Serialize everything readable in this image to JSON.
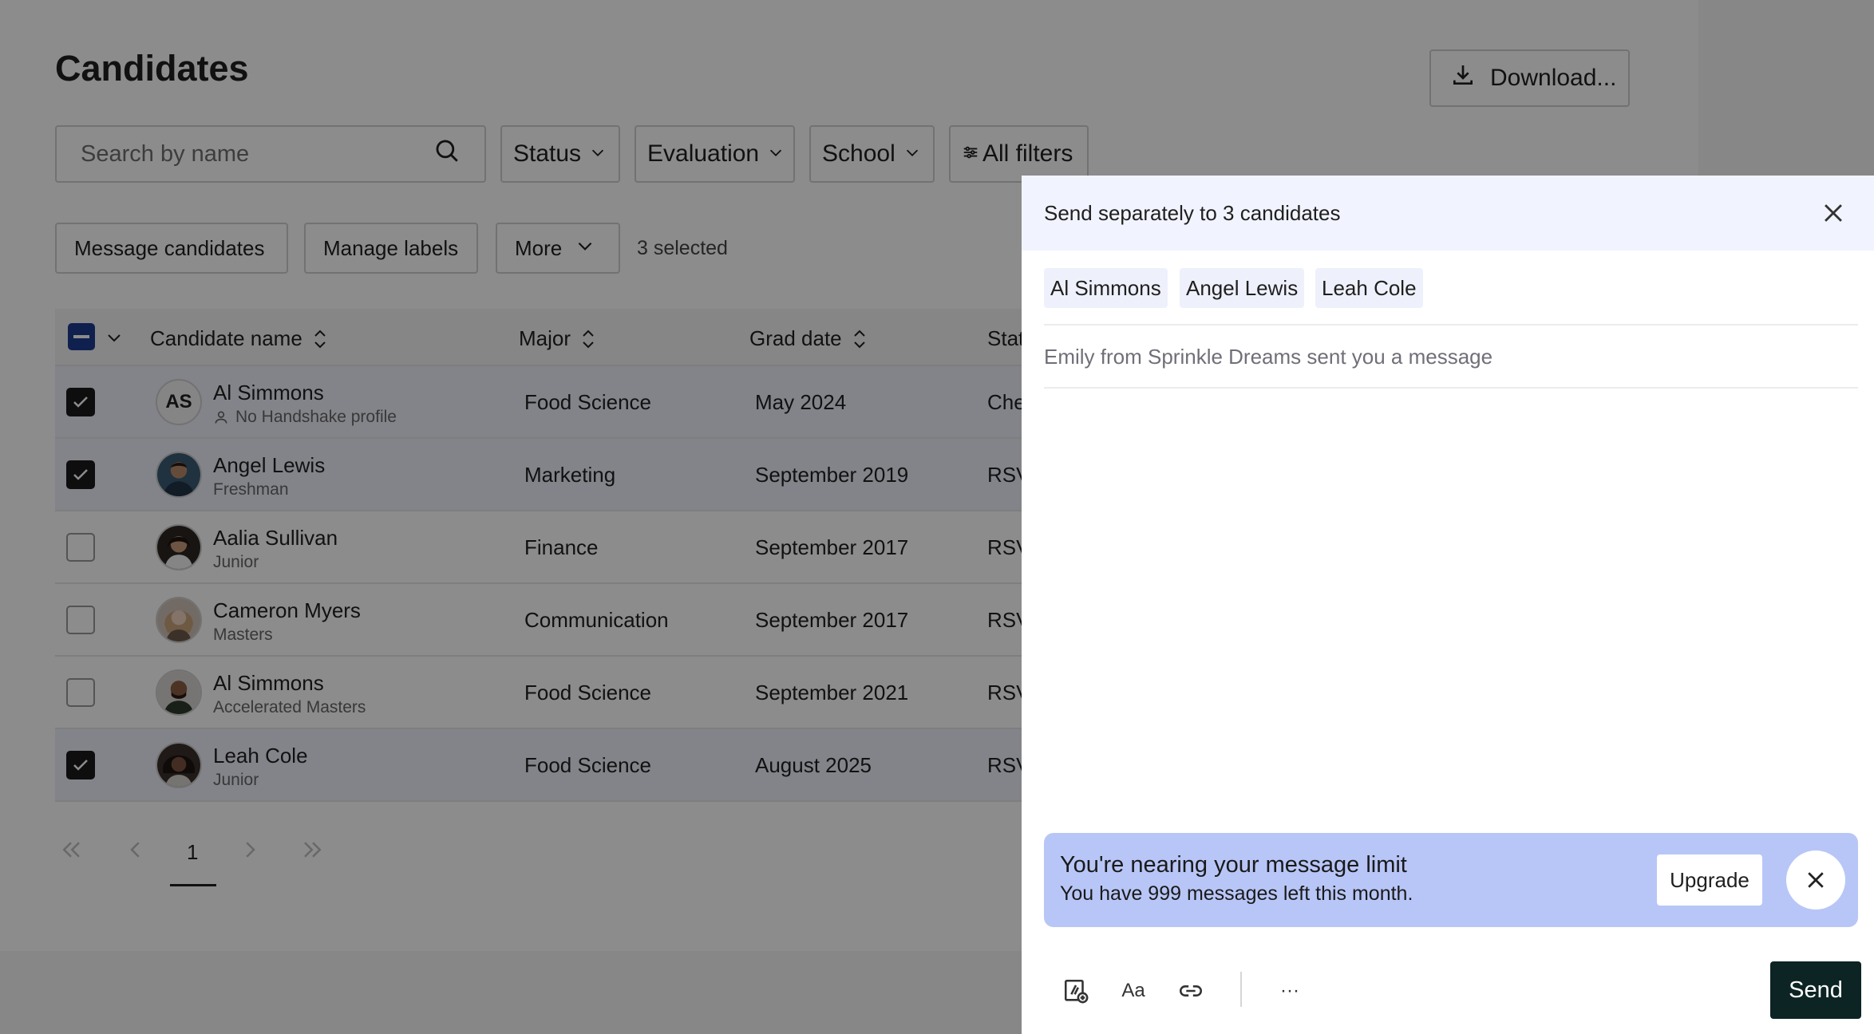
{
  "page": {
    "title": "Candidates",
    "download_label": "Download..."
  },
  "search": {
    "placeholder": "Search by name"
  },
  "filters": [
    {
      "label": "Status"
    },
    {
      "label": "Evaluation"
    },
    {
      "label": "School"
    },
    {
      "label": "All filters"
    }
  ],
  "actions": {
    "message_candidates": "Message candidates",
    "manage_labels": "Manage labels",
    "more": "More",
    "selected_count": "3 selected"
  },
  "table": {
    "columns": {
      "candidate_name": "Candidate name",
      "major": "Major",
      "grad_date": "Grad date",
      "status": "Stat"
    },
    "rows": [
      {
        "selected": true,
        "initials": "AS",
        "name": "Al Simmons",
        "sub": "No Handshake profile",
        "major": "Food Science",
        "grad_date": "May 2024",
        "status": "Che"
      },
      {
        "selected": true,
        "initials": "",
        "name": "Angel Lewis",
        "sub": "Freshman",
        "major": "Marketing",
        "grad_date": "September 2019",
        "status": "RSV"
      },
      {
        "selected": false,
        "initials": "",
        "name": "Aalia Sullivan",
        "sub": "Junior",
        "major": "Finance",
        "grad_date": "September 2017",
        "status": "RSV"
      },
      {
        "selected": false,
        "initials": "",
        "name": "Cameron Myers",
        "sub": "Masters",
        "major": "Communication",
        "grad_date": "September 2017",
        "status": "RSV"
      },
      {
        "selected": false,
        "initials": "",
        "name": "Al Simmons",
        "sub": "Accelerated Masters",
        "major": "Food Science",
        "grad_date": "September 2021",
        "status": "RSV"
      },
      {
        "selected": true,
        "initials": "",
        "name": "Leah Cole",
        "sub": "Junior",
        "major": "Food Science",
        "grad_date": "August 2025",
        "status": "RSV"
      }
    ]
  },
  "pagination": {
    "current_page": "1"
  },
  "drawer": {
    "title": "Send separately to 3 candidates",
    "recipients": [
      "Al Simmons",
      "Angel Lewis",
      "Leah Cole"
    ],
    "subject": "Emily from Sprinkle Dreams sent you a message",
    "limit_title": "You're nearing your message limit",
    "limit_text": "You have 999 messages left this month.",
    "upgrade_label": "Upgrade",
    "format_label": "Aa",
    "more_label": "···",
    "send_label": "Send"
  }
}
